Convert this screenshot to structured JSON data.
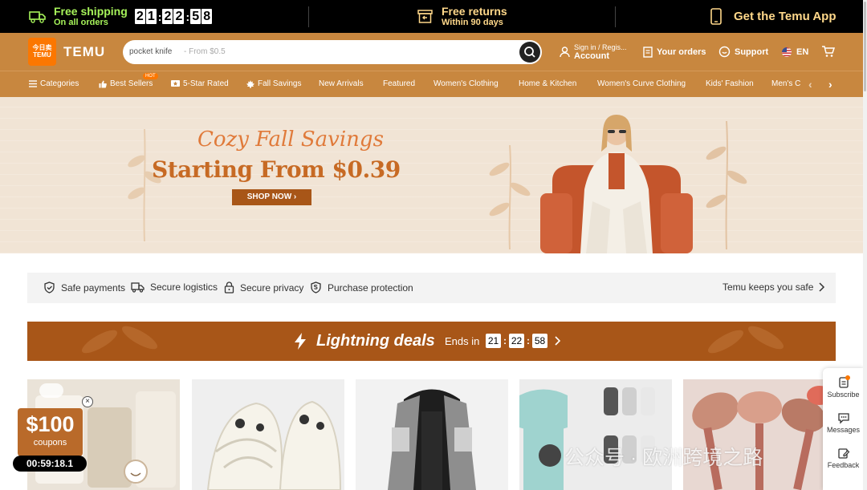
{
  "promo_bar": {
    "shipping_title": "Free shipping",
    "shipping_sub": "On all orders",
    "timer_digits": [
      "2",
      "1",
      "2",
      "2",
      "5",
      "8"
    ],
    "returns_title": "Free returns",
    "returns_sub": "Within 90 days",
    "app_label": "Get the Temu App"
  },
  "header": {
    "logo_line1": "今日卖",
    "logo_line2": "TEMU",
    "brand": "TEMU",
    "search_value": "pocket knife",
    "search_placeholder": "- From $0.5",
    "signin_line1": "Sign in / Regis...",
    "signin_line2": "Account",
    "orders": "Your orders",
    "support": "Support",
    "language": "EN"
  },
  "categories": {
    "menu": "Categories",
    "best_sellers": "Best Sellers",
    "hot_badge": "HOT",
    "five_star": "5-Star Rated",
    "fall_savings": "Fall Savings",
    "new_arrivals": "New Arrivals",
    "featured": "Featured",
    "womens_clothing": "Women's Clothing",
    "home_kitchen": "Home & Kitchen",
    "womens_curve": "Women's Curve Clothing",
    "kids_fashion": "Kids' Fashion",
    "mens_partial": "Men's C"
  },
  "hero": {
    "script_title": "Cozy Fall Savings",
    "main_title": "Starting From $0.39",
    "cta": "SHOP NOW ›"
  },
  "safe_strip": {
    "safe_payments": "Safe payments",
    "secure_logistics": "Secure logistics",
    "secure_privacy": "Secure privacy",
    "purchase_protection": "Purchase protection",
    "keeps_safe": "Temu keeps you safe"
  },
  "deals": {
    "title": "Lightning deals",
    "ends_in": "Ends in",
    "hours": "21",
    "minutes": "22",
    "seconds": "58"
  },
  "coupon": {
    "amount": "$100",
    "label": "coupons",
    "timer": "00:59:18.1"
  },
  "side_panel": {
    "subscribe": "Subscribe",
    "messages": "Messages",
    "feedback": "Feedback"
  },
  "watermark": "公众号 · 欧洲跨境之路",
  "colors": {
    "promo_bg": "#000000",
    "promo_green": "#a6f25a",
    "promo_gold": "#ffd88a",
    "header_bg": "#c8873f",
    "logo_orange": "#fb7701",
    "deals_bg": "#a85618",
    "hero_bg": "#f1e4d5"
  }
}
